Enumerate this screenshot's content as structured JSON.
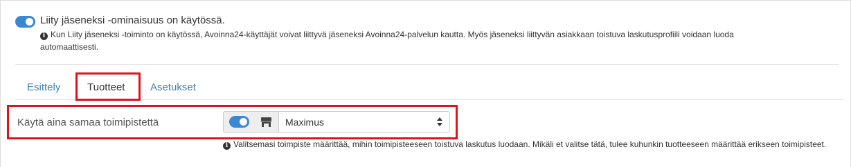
{
  "join": {
    "enabled": true,
    "title": "Liity jäseneksi -ominaisuus on käytössä.",
    "info": "Kun Liity jäseneksi -toiminto on käytössä, Avoinna24-käyttäjät voivat liittyvä jäseneksi Avoinna24-palvelun kautta. Myös jäseneksi liittyvän asiakkaan toistuva laskutusprofiili voidaan luoda automaattisesti."
  },
  "tabs": [
    {
      "label": "Esittely",
      "active": false
    },
    {
      "label": "Tuotteet",
      "active": true
    },
    {
      "label": "Asetukset",
      "active": false
    }
  ],
  "store_field": {
    "label": "Käytä aina samaa toimipistettä",
    "toggle_enabled": true,
    "addon_icon": "store-icon",
    "selected": "Maximus",
    "info": "Valitsemasi toimpiste määrittää, mihin toimipisteeseen toistuva laskutus luodaan. Mikäli et valitse tätä, tulee kuhunkin tuotteeseen määrittää erikseen toimipisteet."
  },
  "colors": {
    "accent": "#3a87d4",
    "link": "#3d7fb8",
    "highlight": "#e0121b"
  }
}
